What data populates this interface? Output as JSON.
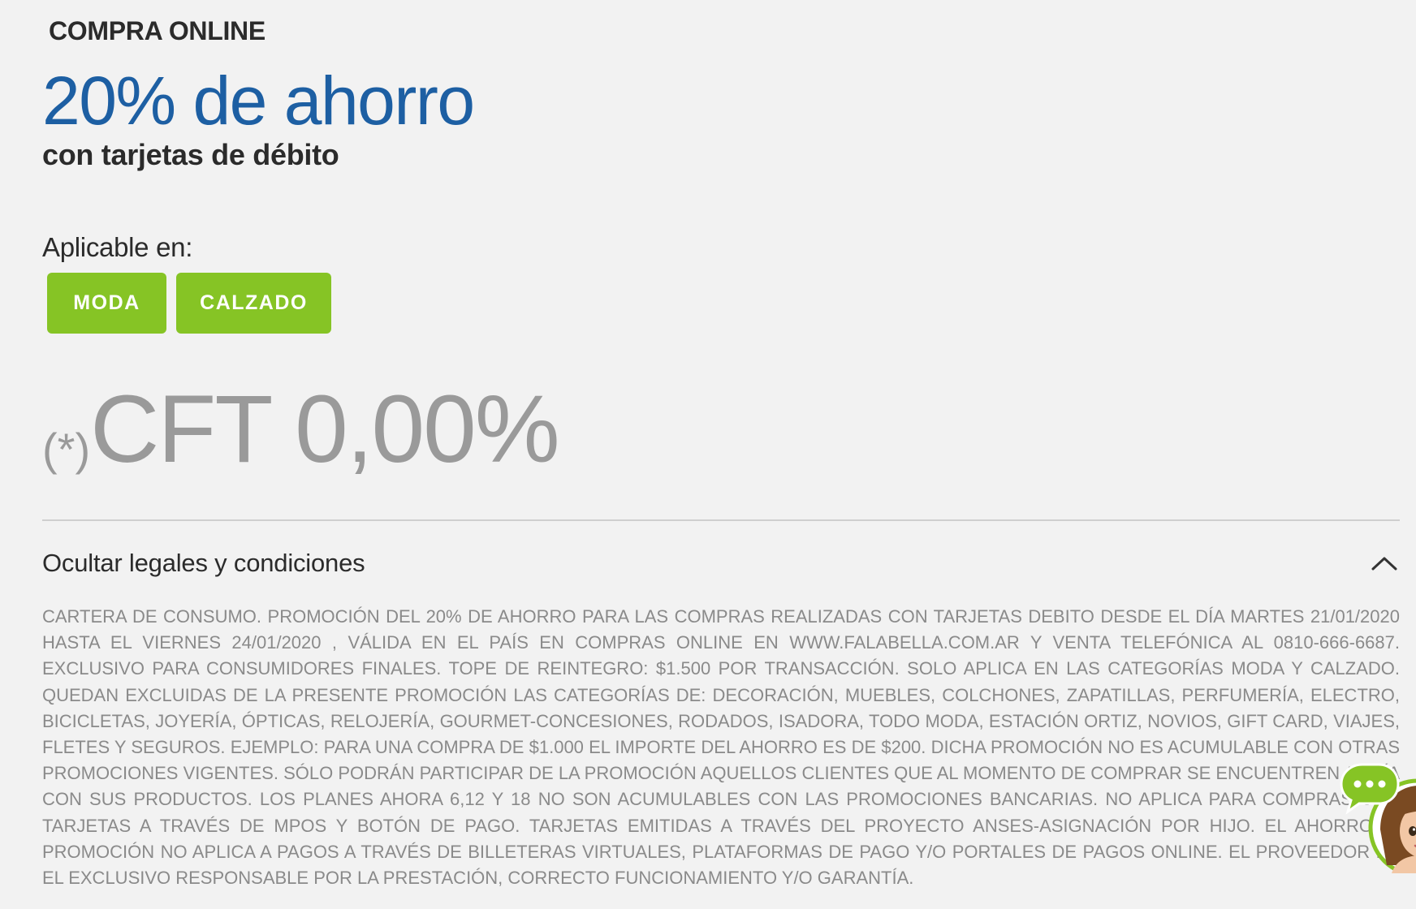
{
  "promo": {
    "channel": "COMPRA ONLINE",
    "headline": "20% de ahorro",
    "subheadline": "con tarjetas de débito",
    "applicable_label": "Aplicable en:",
    "categories": [
      "MODA",
      "CALZADO"
    ],
    "cft_prefix": "(*)",
    "cft_value": "CFT 0,00%"
  },
  "legal": {
    "toggle_label": "Ocultar legales y condiciones",
    "text": "CARTERA DE CONSUMO. PROMOCIÓN DEL 20% DE AHORRO PARA LAS COMPRAS REALIZADAS CON TARJETAS DEBITO DESDE EL DÍA MARTES 21/01/2020 HASTA EL VIERNES 24/01/2020 , VÁLIDA EN EL PAÍS EN COMPRAS ONLINE EN WWW.FALABELLA.COM.AR Y VENTA TELEFÓNICA AL 0810-666-6687. EXCLUSIVO PARA CONSUMIDORES FINALES. TOPE DE REINTEGRO: $1.500 POR TRANSACCIÓN. SOLO APLICA EN LAS CATEGORÍAS MODA Y CALZADO. QUEDAN EXCLUIDAS DE LA PRESENTE PROMOCIÓN LAS CATEGORÍAS DE: DECORACIÓN, MUEBLES, COLCHONES, ZAPATILLAS, PERFUMERÍA, ELECTRO, BICICLETAS, JOYERÍA, ÓPTICAS, RELOJERÍA, GOURMET-CONCESIONES, RODADOS, ISADORA, TODO MODA, ESTACIÓN ORTIZ, NOVIOS, GIFT CARD, VIAJES, FLETES Y SEGUROS. EJEMPLO: PARA UNA COMPRA DE $1.000 EL IMPORTE DEL AHORRO ES DE $200. DICHA PROMOCIÓN NO ES ACUMULABLE CON OTRAS PROMOCIONES VIGENTES. SÓLO PODRÁN PARTICIPAR DE LA PROMOCIÓN AQUELLOS CLIENTES QUE AL MOMENTO DE COMPRAR SE ENCUENTREN AL DÍA CON SUS PRODUCTOS. LOS PLANES AHORA 6,12 Y 18 NO SON ACUMULABLES CON LAS PROMOCIONES BANCARIAS. NO APLICA PARA COMPRAS CON TARJETAS A TRAVÉS DE MPOS Y BOTÓN DE PAGO. TARJETAS EMITIDAS A TRAVÉS DEL PROYECTO ANSES-ASIGNACIÓN POR HIJO. EL AHORRO/LA PROMOCIÓN NO APLICA A PAGOS A TRAVÉS DE BILLETERAS VIRTUALES, PLATAFORMAS DE PAGO Y/O PORTALES DE PAGOS ONLINE. EL PROVEEDOR ES EL EXCLUSIVO RESPONSABLE POR LA PRESTACIÓN, CORRECTO FUNCIONAMIENTO Y/O GARANTÍA."
  },
  "colors": {
    "headline": "#1d5fa3",
    "chip": "#86c425",
    "muted": "#9a9a9a",
    "background": "#f2f2f2"
  },
  "icons": {
    "toggle": "chevron-up-icon",
    "assistant": "chat-assistant-icon"
  }
}
